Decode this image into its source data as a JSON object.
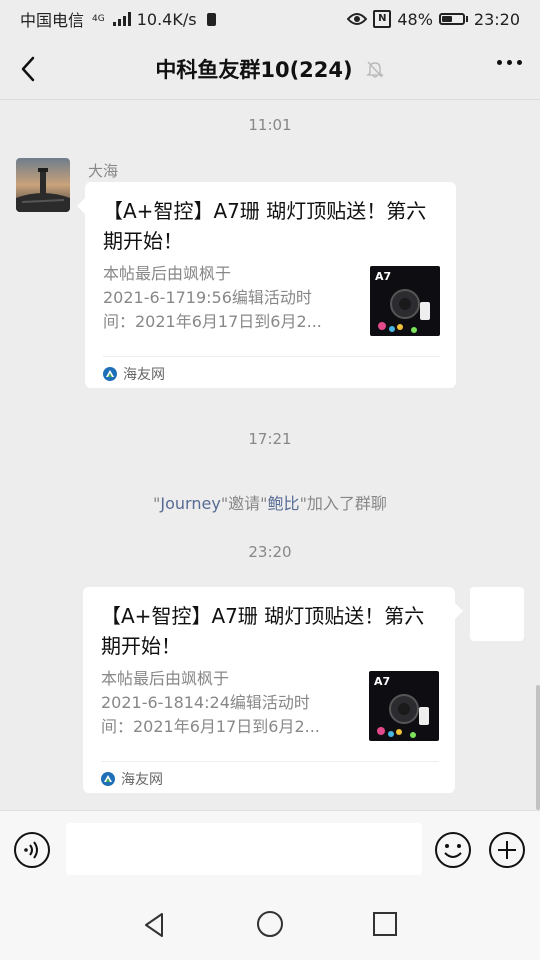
{
  "status_bar": {
    "carrier": "中国电信",
    "network_badge_top": "4G",
    "network_badge_bottom": "",
    "speed": "10.4K/s",
    "battery_text": "48%",
    "battery_level": 0.48,
    "time": "23:20"
  },
  "header": {
    "title": "中科鱼友群10(224)"
  },
  "chat": {
    "time_1": "11:01",
    "sender_name": "大海",
    "card_1": {
      "title": "【A+智控】A7珊 瑚灯顶贴送！第六期开始！",
      "desc": "本帖最后由飒枫于\n2021-6-1719:56编辑活动时\n间：2021年6月17日到6月2...",
      "thumb_label": "A7",
      "source": "海友网"
    },
    "time_2": "17:21",
    "system_message": {
      "quote_open": "\"",
      "inviter": "Journey",
      "mid": "\"邀请\"",
      "invitee": "鲍比",
      "end": "\"加入了群聊"
    },
    "time_3": "23:20",
    "card_2": {
      "title": "【A+智控】A7珊 瑚灯顶贴送！第六期开始！",
      "desc": "本帖最后由飒枫于\n2021-6-1814:24编辑活动时\n间：2021年6月17日到6月2...",
      "thumb_label": "A7",
      "source": "海友网"
    }
  },
  "input": {
    "value": "",
    "placeholder": ""
  },
  "colors": {
    "background": "#ededed",
    "link": "#576b95",
    "bubble": "#ffffff"
  }
}
